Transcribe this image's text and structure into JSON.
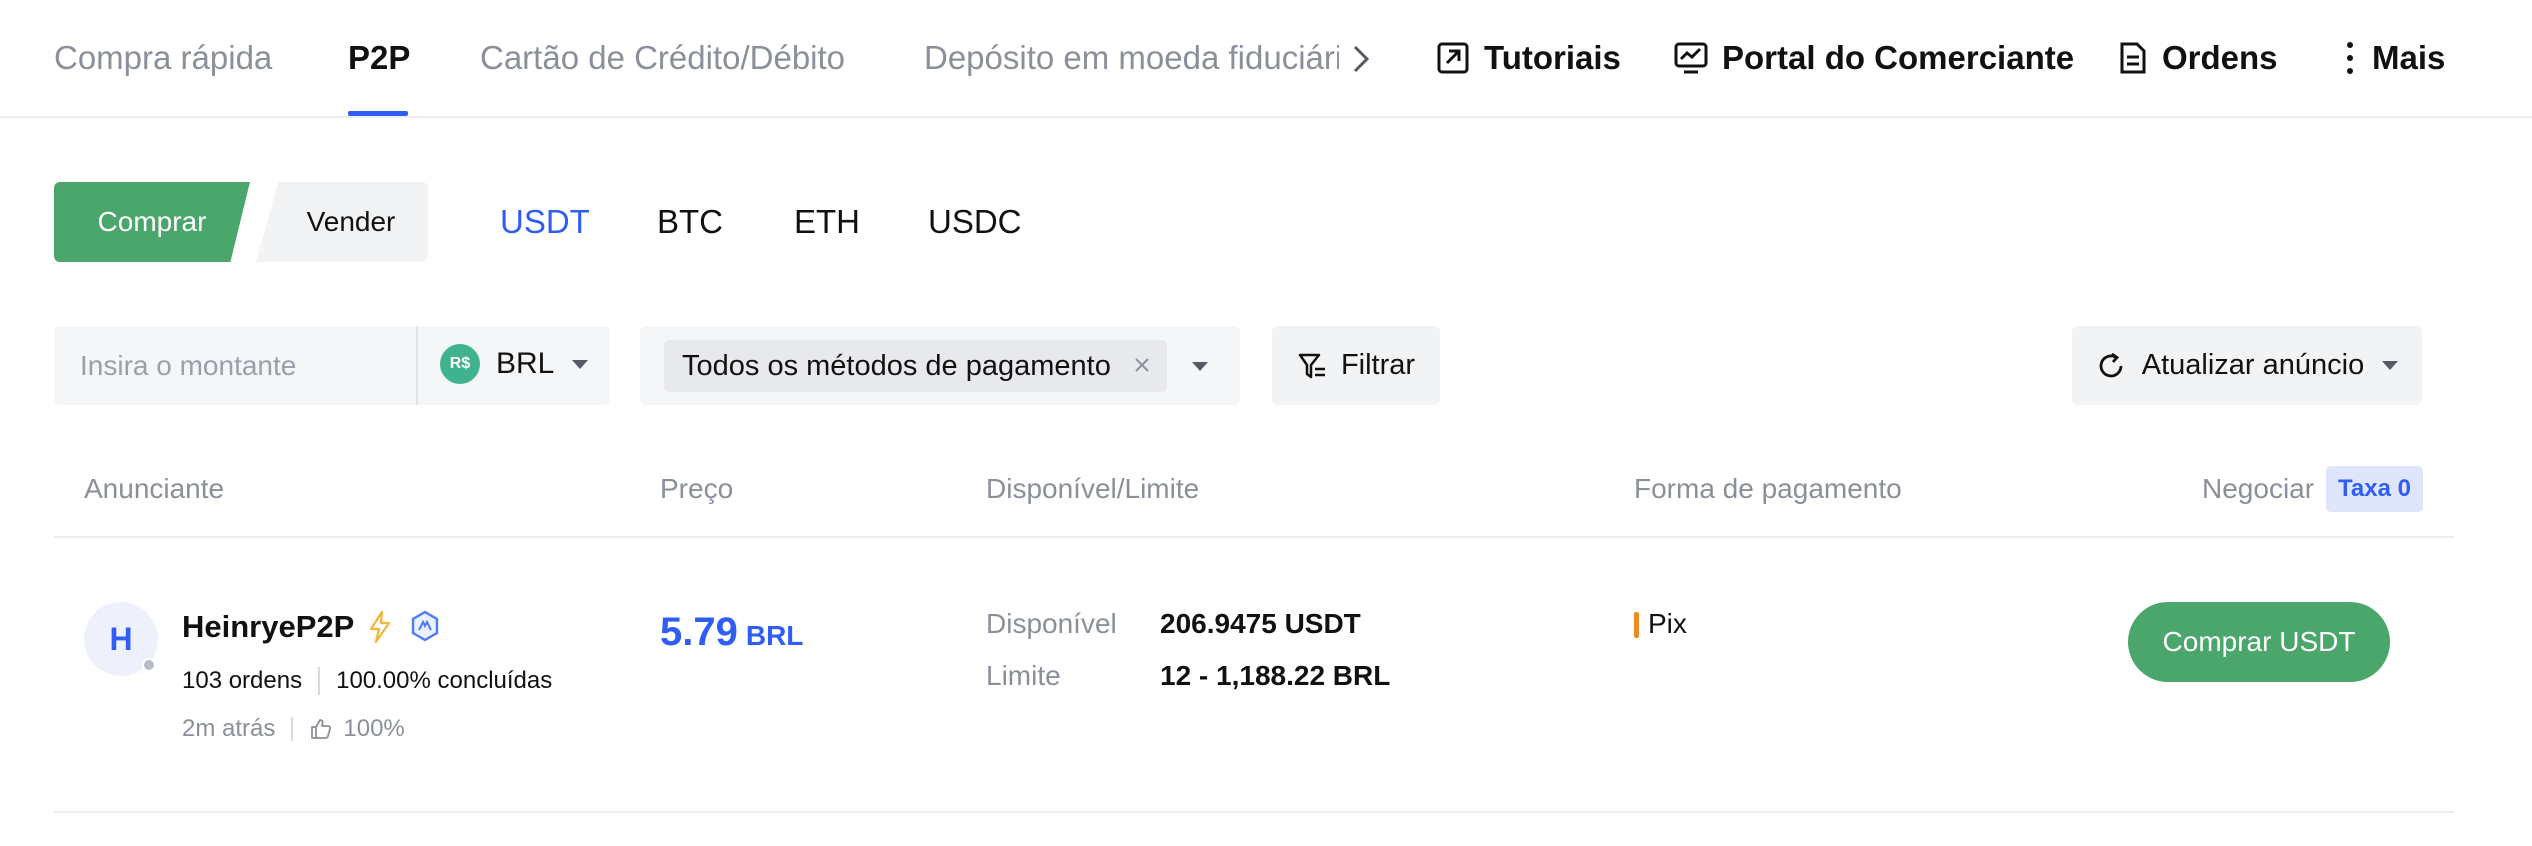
{
  "nav": {
    "tabs": [
      {
        "label": "Compra rápida"
      },
      {
        "label": "P2P"
      },
      {
        "label": "Cartão de Crédito/Débito"
      },
      {
        "label": "Depósito em moeda fiduciária"
      }
    ],
    "active_tab": "P2P",
    "right": {
      "tutorials": "Tutoriais",
      "merchant_portal": "Portal do Comerciante",
      "orders": "Ordens",
      "more": "Mais"
    }
  },
  "trade": {
    "buy_label": "Comprar",
    "sell_label": "Vender",
    "coins": [
      "USDT",
      "BTC",
      "ETH",
      "USDC"
    ],
    "active_coin": "USDT"
  },
  "filters": {
    "amount_placeholder": "Insira o montante",
    "amount_value": "",
    "currency": "BRL",
    "currency_badge": "R$",
    "payment_chip": "Todos os métodos de pagamento",
    "filter_label": "Filtrar",
    "refresh_label": "Atualizar anúncio"
  },
  "table": {
    "headers": {
      "advertiser": "Anunciante",
      "price": "Preço",
      "available_limit": "Disponível/Limite",
      "payment": "Forma de pagamento",
      "trade": "Negociar",
      "fee_badge": "Taxa 0"
    },
    "rows": [
      {
        "avatar_letter": "H",
        "name": "HeinryeP2P",
        "orders": "103 ordens",
        "completion": "100.00% concluídas",
        "last_seen": "2m atrás",
        "rating": "100%",
        "price": "5.79",
        "price_currency": "BRL",
        "available_label": "Disponível",
        "available_value": "206.9475 USDT",
        "limit_label": "Limite",
        "limit_value": "12 - 1,188.22 BRL",
        "payment_method": "Pix",
        "payment_color": "#f08a24",
        "action_label": "Comprar USDT"
      }
    ]
  },
  "colors": {
    "accent_blue": "#2f5df5",
    "buy_green": "#4aa66b",
    "muted_text": "#8a8f99"
  }
}
